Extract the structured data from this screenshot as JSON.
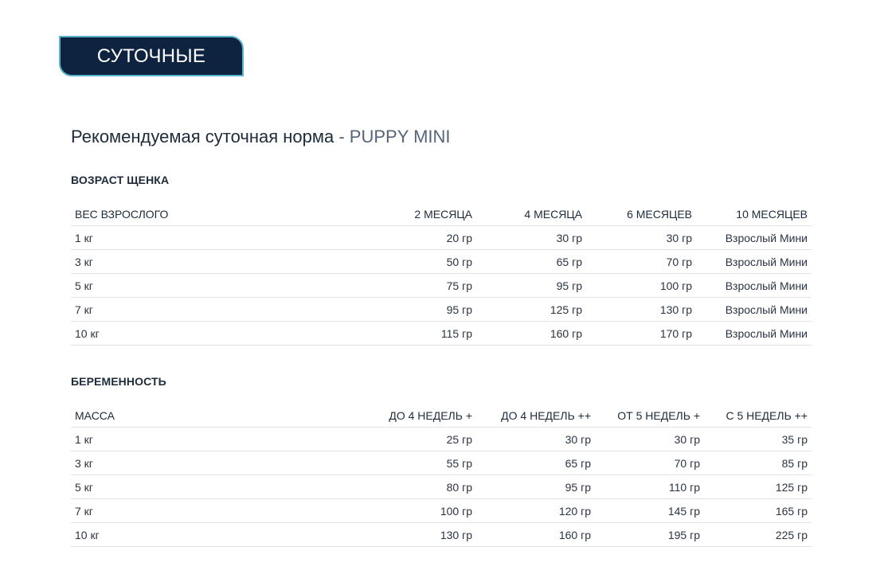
{
  "tab": {
    "label": "СУТОЧНЫЕ"
  },
  "page": {
    "title_main": "Рекомендуемая суточная норма",
    "title_separator": " - ",
    "title_product": "PUPPY MINI"
  },
  "age_section": {
    "title": "ВОЗРАСТ ЩЕНКА",
    "headers": [
      "ВЕС ВЗРОСЛОГО",
      "2 МЕСЯЦА",
      "4 МЕСЯЦА",
      "6 МЕСЯЦЕВ",
      "10 МЕСЯЦЕВ"
    ],
    "rows": [
      [
        "1 кг",
        "20 гр",
        "30 гр",
        "30 гр",
        "Взрослый Мини"
      ],
      [
        "3 кг",
        "50 гр",
        "65 гр",
        "70 гр",
        "Взрослый Мини"
      ],
      [
        "5 кг",
        "75 гр",
        "95 гр",
        "100 гр",
        "Взрослый Мини"
      ],
      [
        "7 кг",
        "95 гр",
        "125 гр",
        "130 гр",
        "Взрослый Мини"
      ],
      [
        "10 кг",
        "115 гр",
        "160 гр",
        "170 гр",
        "Взрослый Мини"
      ]
    ]
  },
  "pregnancy_section": {
    "title": "БЕРЕМЕННОСТЬ",
    "headers": [
      "МАССА",
      "ДО 4 НЕДЕЛЬ +",
      "ДО 4 НЕДЕЛЬ ++",
      "ОТ 5 НЕДЕЛЬ +",
      "С 5 НЕДЕЛЬ ++"
    ],
    "rows": [
      [
        "1 кг",
        "25 гр",
        "30 гр",
        "30 гр",
        "35 гр"
      ],
      [
        "3 кг",
        "55 гр",
        "65 гр",
        "70 гр",
        "85 гр"
      ],
      [
        "5 кг",
        "80 гр",
        "95 гр",
        "110 гр",
        "125 гр"
      ],
      [
        "7 кг",
        "100 гр",
        "120 гр",
        "145 гр",
        "165 гр"
      ],
      [
        "10 кг",
        "130 гр",
        "160 гр",
        "195 гр",
        "225 гр"
      ]
    ]
  },
  "colors": {
    "tab_background": "#0e2340",
    "tab_border": "#5ab4cc",
    "text_primary": "#1d2b3a",
    "text_muted": "#56647a",
    "divider": "#dfe3e8"
  }
}
